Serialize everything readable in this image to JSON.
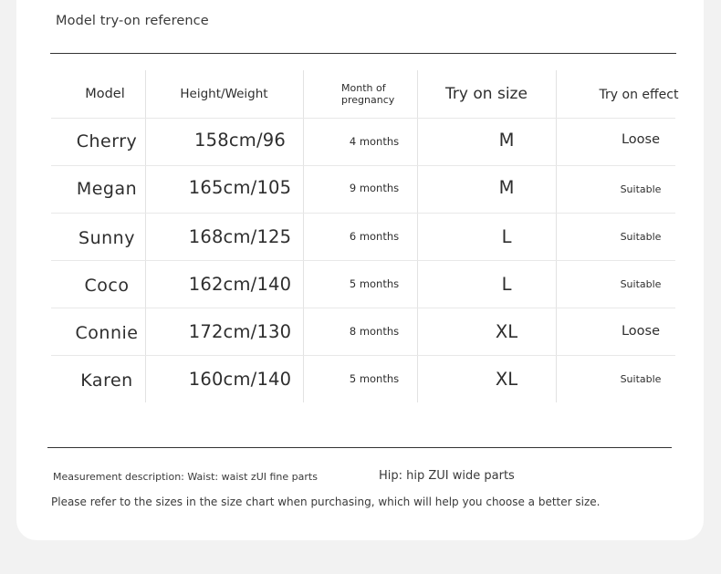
{
  "title": "Model try-on reference",
  "table": {
    "headers": {
      "model": "Model",
      "height_weight": "Height/Weight",
      "month_line1": "Month of",
      "month_line2": "pregnancy",
      "size": "Try on size",
      "effect": "Try on effect"
    },
    "rows": [
      {
        "name": "Cherry",
        "hw": "158cm/96",
        "month": "4 months",
        "size": "M",
        "effect": "Loose"
      },
      {
        "name": "Megan",
        "hw": "165cm/105",
        "month": "9 months",
        "size": "M",
        "effect": "Suitable"
      },
      {
        "name": "Sunny",
        "hw": "168cm/125",
        "month": "6 months",
        "size": "L",
        "effect": "Suitable"
      },
      {
        "name": "Coco",
        "hw": "162cm/140",
        "month": "5 months",
        "size": "L",
        "effect": "Suitable"
      },
      {
        "name": "Connie",
        "hw": "172cm/130",
        "month": "8 months",
        "size": "XL",
        "effect": "Loose"
      },
      {
        "name": "Karen",
        "hw": "160cm/140",
        "month": "5 months",
        "size": "XL",
        "effect": "Suitable"
      }
    ]
  },
  "notes": {
    "measurement": "Measurement description: Waist: waist zUI fine parts",
    "hip": "Hip: hip ZUI wide parts",
    "refer": "Please refer to the sizes in the size chart when purchasing, which will help you choose a better size."
  }
}
